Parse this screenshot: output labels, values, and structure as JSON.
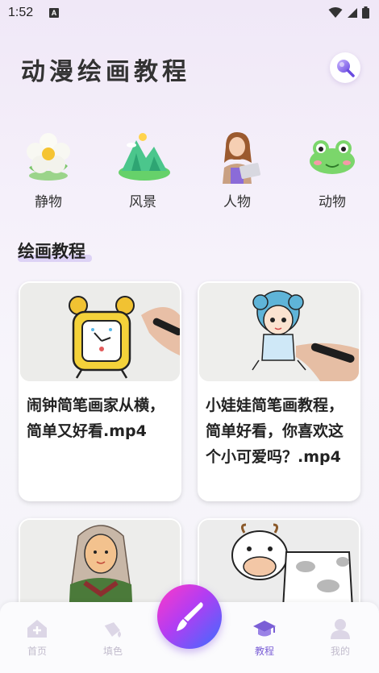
{
  "status_bar": {
    "time": "1:52",
    "notification_glyph": "A"
  },
  "header": {
    "title": "动漫绘画教程",
    "search_icon": "search-icon"
  },
  "categories": [
    {
      "label": "静物",
      "icon": "flower-icon"
    },
    {
      "label": "风景",
      "icon": "landscape-icon"
    },
    {
      "label": "人物",
      "icon": "person-icon"
    },
    {
      "label": "动物",
      "icon": "frog-icon"
    }
  ],
  "section": {
    "title": "绘画教程"
  },
  "cards": [
    {
      "title": "闹钟简笔画家从横，简单又好看.mp4",
      "thumb": "alarm-clock-drawing"
    },
    {
      "title": "小娃娃简笔画教程，简单好看，你喜欢这个小可爱吗？.mp4",
      "thumb": "doll-drawing"
    },
    {
      "title": "",
      "thumb": "girl-drawing"
    },
    {
      "title": "",
      "thumb": "cow-drawing"
    }
  ],
  "bottom_nav": {
    "items": [
      {
        "label": "首页",
        "icon": "home-icon",
        "active": false
      },
      {
        "label": "填色",
        "icon": "paint-bucket-icon",
        "active": false
      },
      {
        "label": "教程",
        "icon": "graduation-cap-icon",
        "active": true
      },
      {
        "label": "我的",
        "icon": "user-icon",
        "active": false
      }
    ],
    "fab_icon": "paintbrush-icon"
  },
  "colors": {
    "accent": "#7b5fd6",
    "inactive": "#c2bccd",
    "fab_start": "#ff39c6",
    "fab_end": "#3b6dff"
  }
}
